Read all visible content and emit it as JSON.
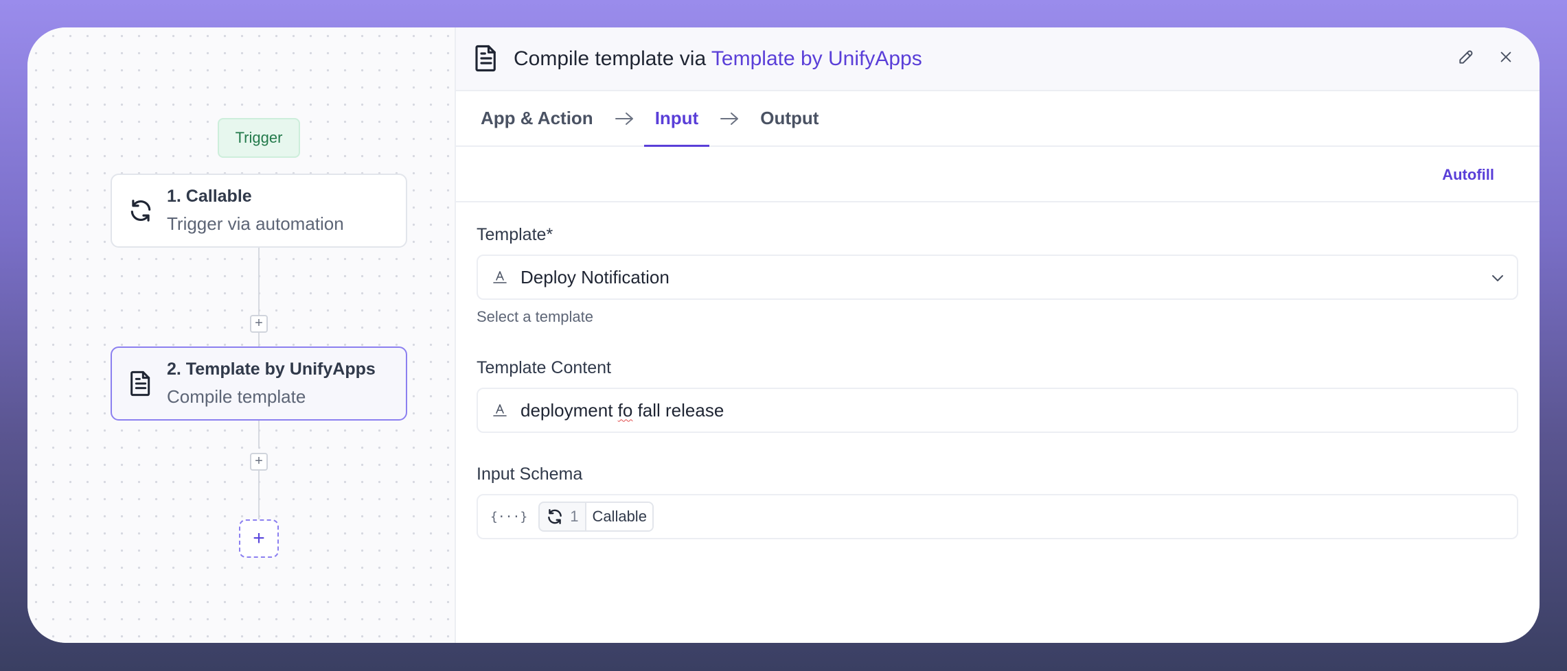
{
  "canvas": {
    "trigger_label": "Trigger",
    "nodes": [
      {
        "title": "1. Callable",
        "subtitle": "Trigger via automation",
        "icon": "refresh-icon"
      },
      {
        "title": "2. Template by UnifyApps",
        "subtitle": "Compile template",
        "icon": "document-icon"
      }
    ],
    "add_symbol": "+"
  },
  "panel": {
    "title_prefix": "Compile template via ",
    "title_app": "Template by UnifyApps",
    "tabs": [
      {
        "label": "App & Action"
      },
      {
        "label": "Input"
      },
      {
        "label": "Output"
      }
    ],
    "active_tab": "Input",
    "autofill_label": "Autofill",
    "fields": {
      "template": {
        "label": "Template*",
        "value": "Deploy Notification",
        "helper": "Select a template"
      },
      "template_content": {
        "label": "Template Content",
        "value_before": "deployment ",
        "value_misspelled": "fo",
        "value_after": " fall release"
      },
      "input_schema": {
        "label": "Input Schema",
        "prefix_symbol": "{···}",
        "chip": {
          "number": "1",
          "label": "Callable"
        }
      }
    }
  },
  "colors": {
    "accent": "#5a3fd8",
    "trigger_bg": "#e7f7ee",
    "trigger_text": "#237a4b"
  }
}
